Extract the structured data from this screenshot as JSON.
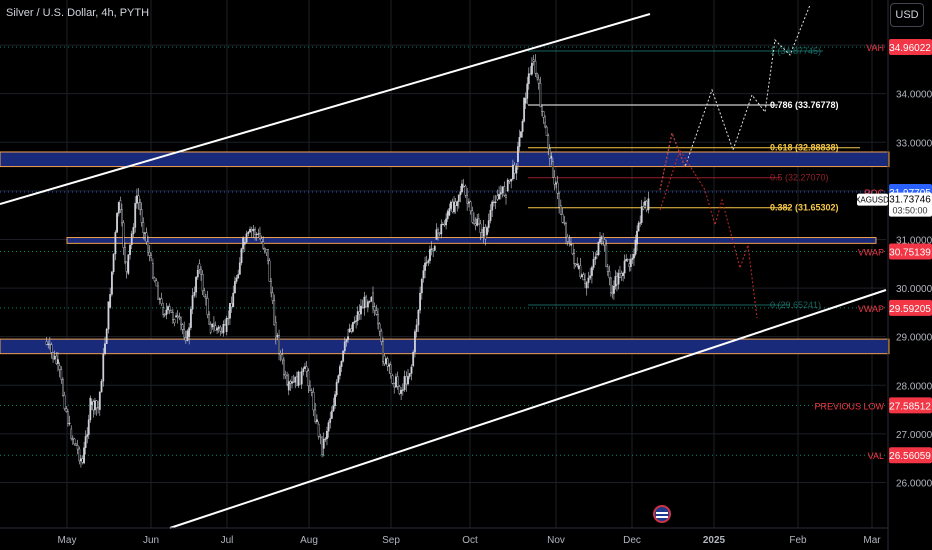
{
  "header": {
    "title": "Silver / U.S. Dollar, 4h, PYTH",
    "currency": "USD"
  },
  "colors": {
    "background": "#000000",
    "candle": "#d1d4dc",
    "channel": "#ffffff",
    "zone_fill": "#1a2a7a",
    "zone_border": "#f0a050",
    "red_label": "#f23645",
    "gold": "#f7c948",
    "grid": "#1c1f28"
  },
  "chart_data": {
    "type": "candlestick",
    "symbol": "XAGUSD",
    "last_price": 31.73746,
    "countdown": "03:50:00",
    "ylim": [
      25.56,
      35.9
    ],
    "y_ticks": [
      "35.00000",
      "34.00000",
      "33.00000",
      "32.00000",
      "31.00000",
      "30.00000",
      "29.00000",
      "28.00000",
      "27.00000",
      "26.00000"
    ],
    "x_ticks": [
      "May",
      "Jun",
      "Jul",
      "Aug",
      "Sep",
      "Oct",
      "Nov",
      "Dec",
      "2025",
      "Feb",
      "Mar"
    ],
    "levels": [
      {
        "name": "VAH",
        "price": 34.96022,
        "label": "34.96022"
      },
      {
        "name": "POC",
        "price": 31.97705,
        "label": "31.97705"
      },
      {
        "name": "VWAP",
        "price": 30.75139,
        "label": "30.75139"
      },
      {
        "name": "VWAP",
        "price": 29.59205,
        "label": "29.59205"
      },
      {
        "name": "PREVIOUS LOW",
        "price": 27.58512,
        "label": "27.58512"
      },
      {
        "name": "VAL",
        "price": 26.56059,
        "label": "26.56059"
      }
    ],
    "fibonacci": [
      {
        "label": "1 (34.87745)",
        "price": 34.87745
      },
      {
        "label": "0.786 (33.76778)",
        "price": 33.76778
      },
      {
        "label": "0.618 (32.88838)",
        "price": 32.88838
      },
      {
        "label": "0.5 (32.27070)",
        "price": 32.2707
      },
      {
        "label": "0.382 (31.65302)",
        "price": 31.65302
      },
      {
        "label": "0 (29.65241)",
        "price": 29.65241
      }
    ],
    "zones": [
      {
        "top": 32.8,
        "bottom": 32.5
      },
      {
        "top": 31.04,
        "bottom": 30.92
      },
      {
        "top": 28.95,
        "bottom": 28.65
      }
    ],
    "series": [
      {
        "x": "Apr 23",
        "y": 28.9
      },
      {
        "x": "Apr 28",
        "y": 28.4
      },
      {
        "x": "May 2",
        "y": 27.1
      },
      {
        "x": "May 7",
        "y": 26.4
      },
      {
        "x": "May 10",
        "y": 27.6
      },
      {
        "x": "May 13",
        "y": 27.5
      },
      {
        "x": "May 17",
        "y": 29.6
      },
      {
        "x": "May 21",
        "y": 31.8
      },
      {
        "x": "May 24",
        "y": 30.3
      },
      {
        "x": "May 28",
        "y": 31.9
      },
      {
        "x": "Jun 3",
        "y": 30.5
      },
      {
        "x": "Jun 7",
        "y": 29.6
      },
      {
        "x": "Jun 12",
        "y": 29.4
      },
      {
        "x": "Jun 17",
        "y": 29.0
      },
      {
        "x": "Jun 21",
        "y": 30.5
      },
      {
        "x": "Jun 26",
        "y": 29.2
      },
      {
        "x": "Jul 1",
        "y": 29.1
      },
      {
        "x": "Jul 8",
        "y": 30.9
      },
      {
        "x": "Jul 12",
        "y": 31.2
      },
      {
        "x": "Jul 17",
        "y": 30.8
      },
      {
        "x": "Jul 20",
        "y": 29.3
      },
      {
        "x": "Jul 25",
        "y": 27.9
      },
      {
        "x": "Aug 2",
        "y": 28.3
      },
      {
        "x": "Aug 6",
        "y": 27.2
      },
      {
        "x": "Aug 8",
        "y": 26.7
      },
      {
        "x": "Aug 13",
        "y": 27.8
      },
      {
        "x": "Aug 18",
        "y": 29.1
      },
      {
        "x": "Aug 23",
        "y": 29.6
      },
      {
        "x": "Aug 27",
        "y": 29.9
      },
      {
        "x": "Sep 1",
        "y": 28.6
      },
      {
        "x": "Sep 4",
        "y": 28.2
      },
      {
        "x": "Sep 8",
        "y": 27.9
      },
      {
        "x": "Sep 12",
        "y": 28.4
      },
      {
        "x": "Sep 16",
        "y": 30.2
      },
      {
        "x": "Sep 21",
        "y": 31.0
      },
      {
        "x": "Sep 26",
        "y": 31.5
      },
      {
        "x": "Oct 1",
        "y": 32.1
      },
      {
        "x": "Oct 5",
        "y": 31.4
      },
      {
        "x": "Oct 10",
        "y": 31.1
      },
      {
        "x": "Oct 14",
        "y": 31.9
      },
      {
        "x": "Oct 18",
        "y": 32.0
      },
      {
        "x": "Oct 22",
        "y": 32.6
      },
      {
        "x": "Oct 25",
        "y": 33.8
      },
      {
        "x": "Oct 28",
        "y": 34.7
      },
      {
        "x": "Oct 30",
        "y": 34.3
      },
      {
        "x": "Nov 2",
        "y": 33.4
      },
      {
        "x": "Nov 5",
        "y": 32.6
      },
      {
        "x": "Nov 8",
        "y": 31.7
      },
      {
        "x": "Nov 12",
        "y": 30.9
      },
      {
        "x": "Nov 15",
        "y": 30.4
      },
      {
        "x": "Nov 18",
        "y": 30.0
      },
      {
        "x": "Nov 22",
        "y": 30.7
      },
      {
        "x": "Nov 25",
        "y": 31.0
      },
      {
        "x": "Nov 28",
        "y": 29.9
      },
      {
        "x": "Dec 1",
        "y": 30.3
      },
      {
        "x": "Dec 4",
        "y": 30.5
      },
      {
        "x": "Dec 7",
        "y": 30.9
      },
      {
        "x": "Dec 10",
        "y": 31.7
      },
      {
        "x": "Dec 12",
        "y": 31.74
      }
    ]
  }
}
